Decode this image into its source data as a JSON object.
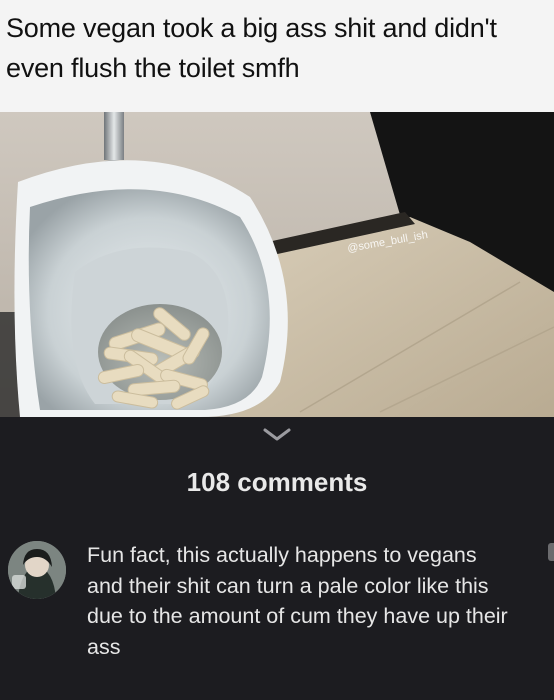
{
  "post": {
    "title": "Some vegan took a big ass shit and didn't even flush the toilet smfh",
    "watermark": "@some_bull_ish"
  },
  "comments": {
    "count_label": "108 comments",
    "items": [
      {
        "text": "Fun fact, this actually happens to vegans and their shit can turn a pale color like this due to the amount of cum they have up their ass"
      }
    ]
  },
  "colors": {
    "header_bg": "#f4f4f4",
    "dark_bg": "#1c1c20",
    "text_light": "#e6e6e6"
  }
}
